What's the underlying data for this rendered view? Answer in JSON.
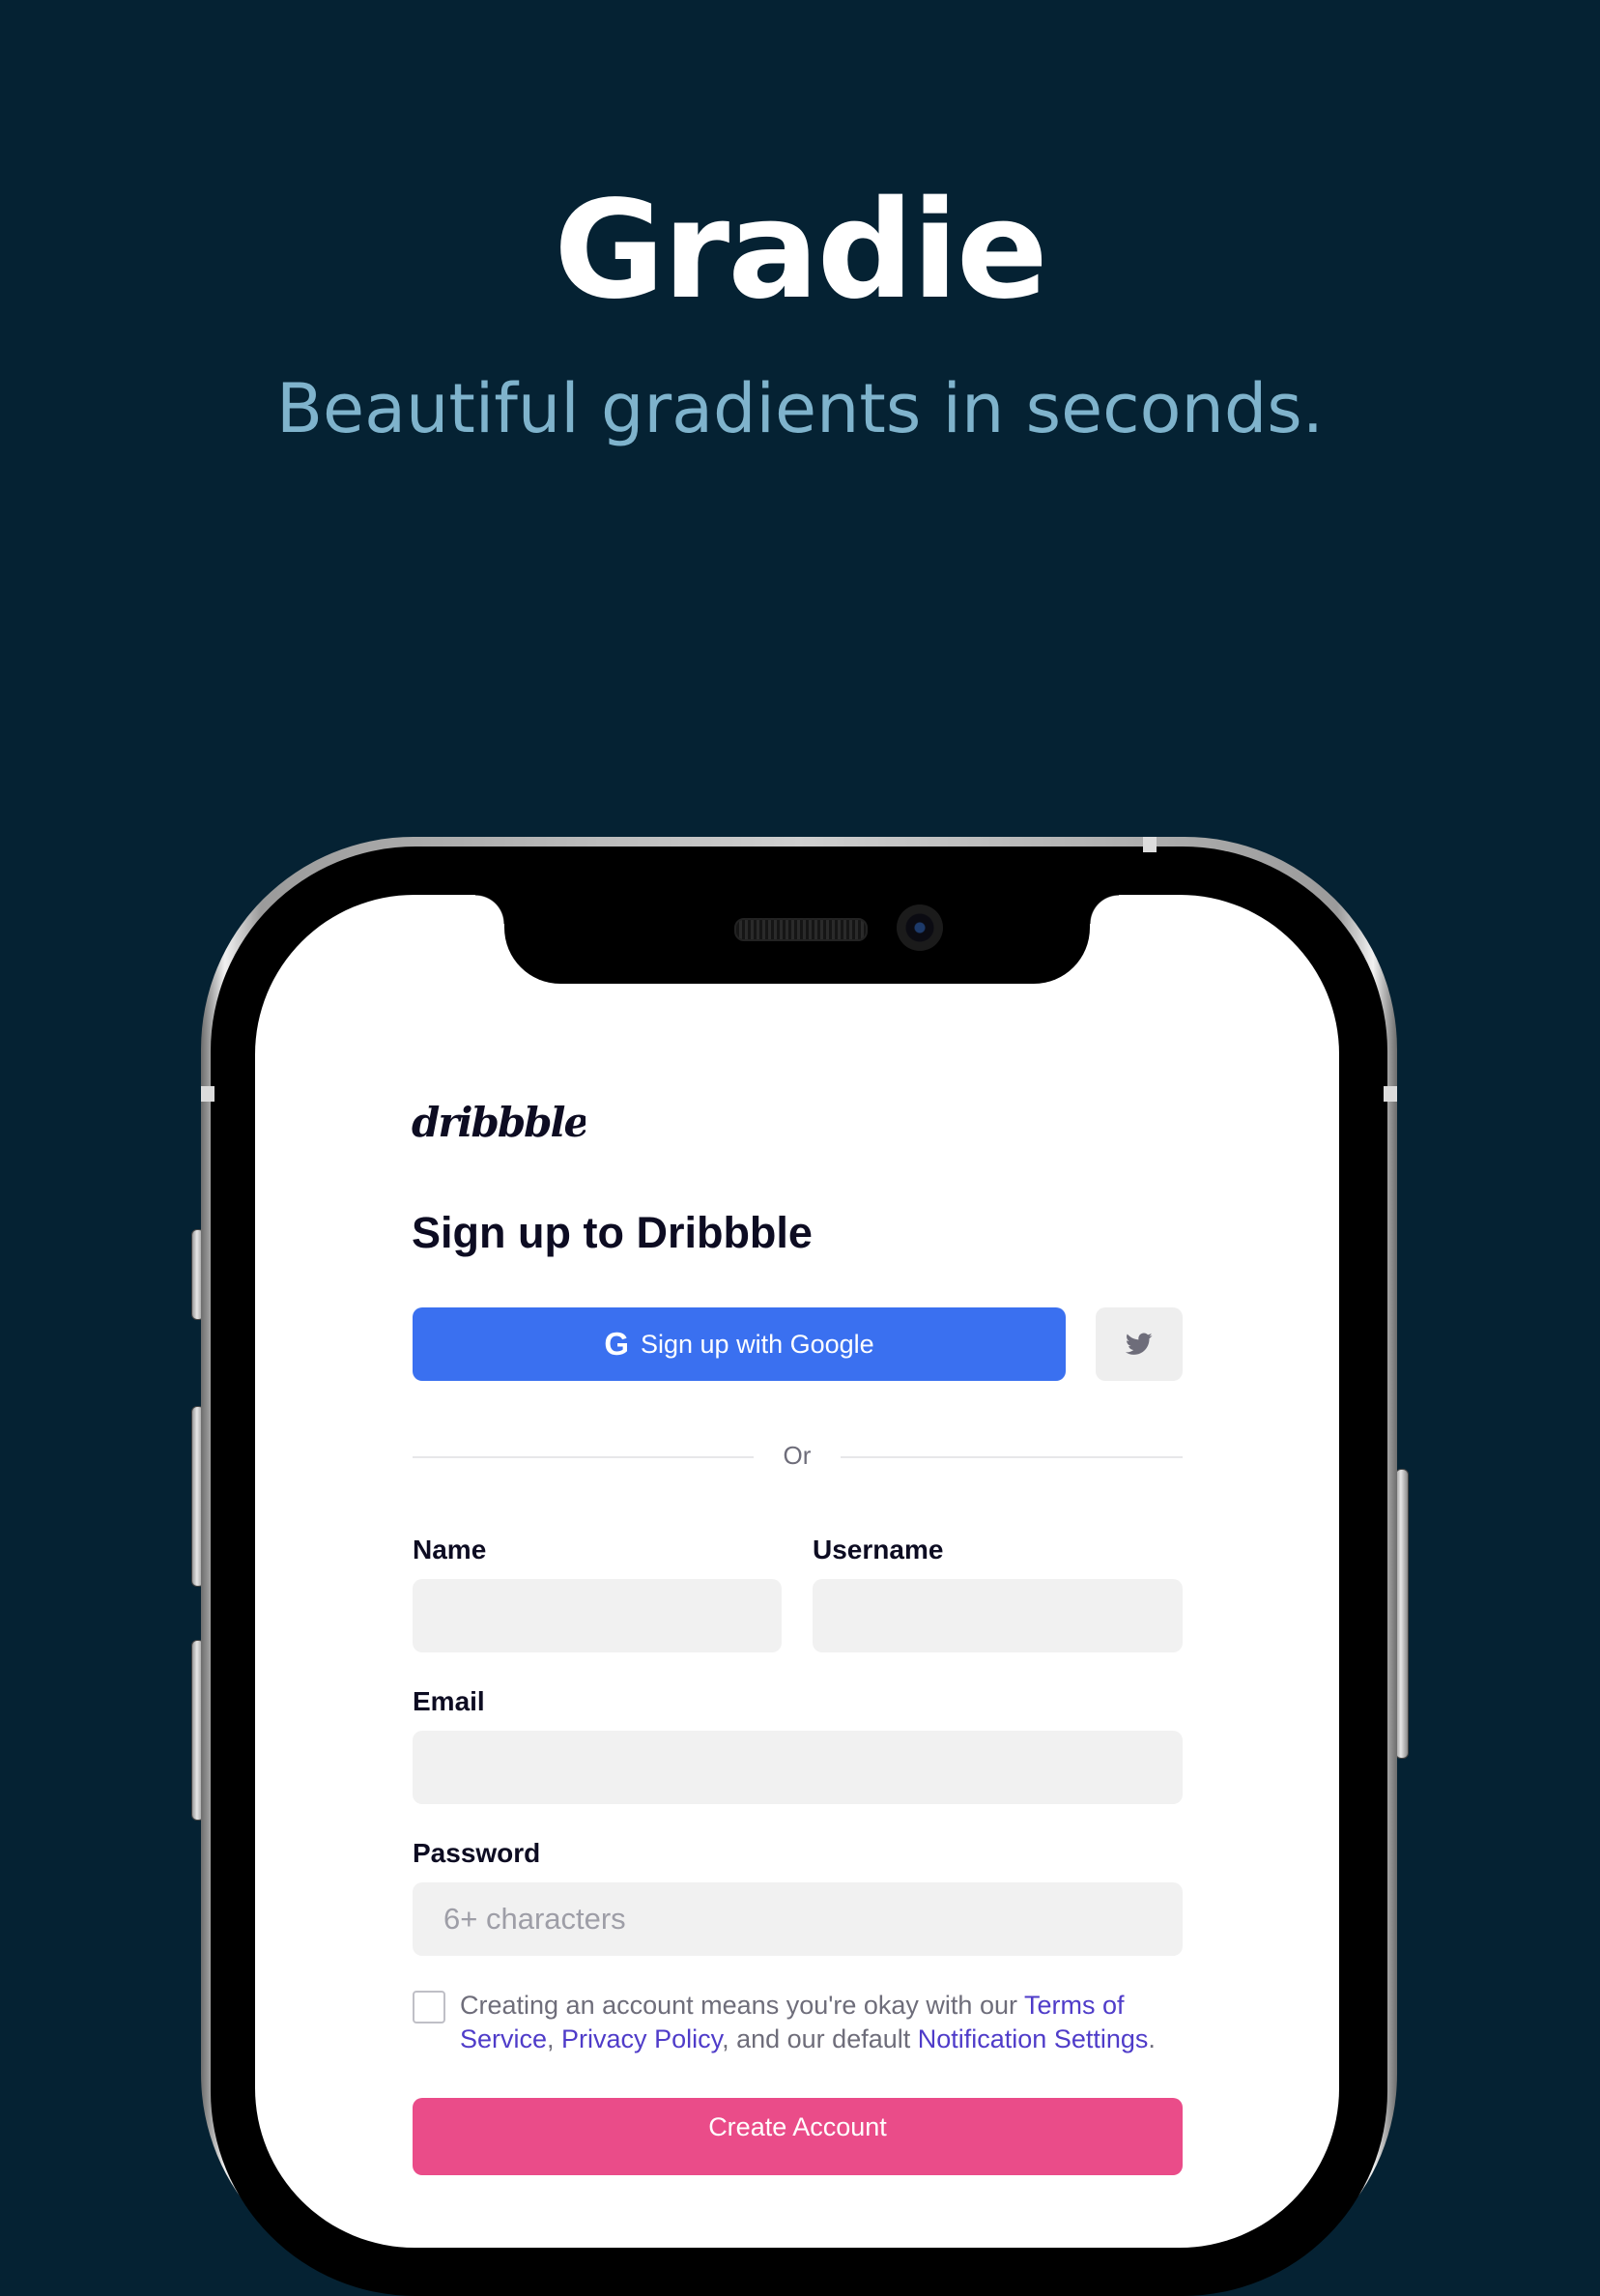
{
  "hero": {
    "title": "Gradie",
    "subtitle": "Beautiful gradients in seconds."
  },
  "signup": {
    "logo_text": "dribbble",
    "title": "Sign up to Dribbble",
    "google_button_icon": "google-g-icon",
    "google_button_icon_char": "G",
    "google_button_label": "Sign up with Google",
    "twitter_button_icon": "twitter-icon",
    "divider_text": "Or",
    "name_label": "Name",
    "name_value": "",
    "username_label": "Username",
    "username_value": "",
    "email_label": "Email",
    "email_value": "",
    "password_label": "Password",
    "password_placeholder": "6+ characters",
    "terms": {
      "checked": false,
      "text_1": "Creating an account means you're okay with our ",
      "link_terms": "Terms of Service",
      "comma": ", ",
      "link_privacy": "Privacy Policy",
      "text_2": ", and our default ",
      "link_notifications": "Notification Settings",
      "period": "."
    },
    "create_button_label": "Create Account"
  },
  "colors": {
    "background": "#052233",
    "subtitle": "#7fb3cc",
    "google_blue": "#3a70f0",
    "dribbble_pink": "#ea4c89",
    "link": "#4f3cc9"
  }
}
